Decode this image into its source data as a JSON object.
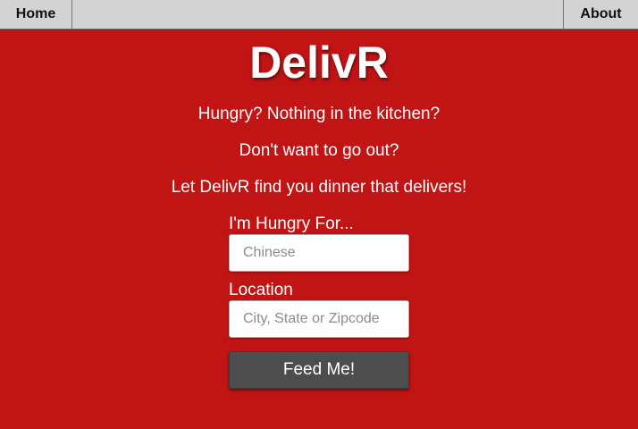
{
  "nav": {
    "home_label": "Home",
    "about_label": "About"
  },
  "hero": {
    "title": "DelivR",
    "line1": "Hungry? Nothing in the kitchen?",
    "line2": "Don't want to go out?",
    "line3": "Let DelivR find you dinner that delivers!"
  },
  "form": {
    "food_label": "I'm Hungry For...",
    "food_placeholder": "Chinese",
    "food_value": "",
    "location_label": "Location",
    "location_placeholder": "City, State or Zipcode",
    "location_value": "",
    "submit_label": "Feed Me!"
  },
  "colors": {
    "background": "#c11415",
    "navbar": "#d3d3d3",
    "button": "#4d4d4d"
  }
}
